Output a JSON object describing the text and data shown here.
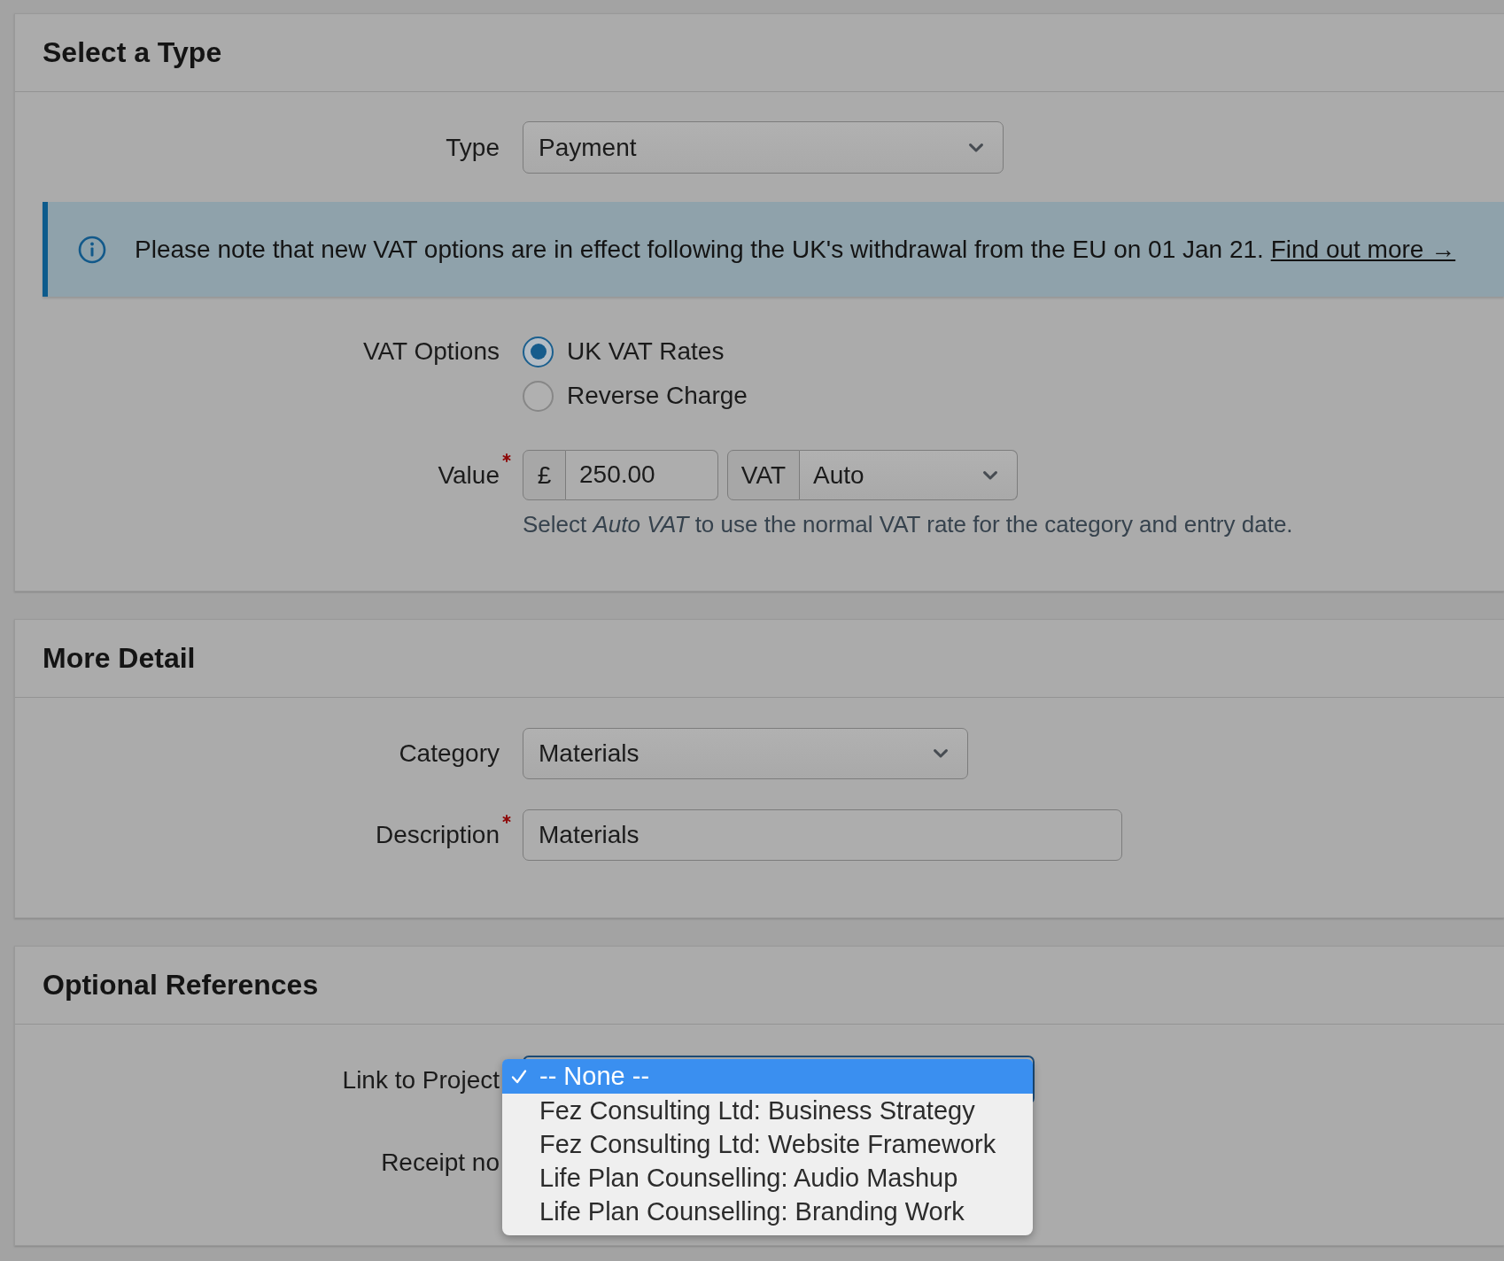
{
  "sections": [
    {
      "title": "Select a Type",
      "rows": [
        {
          "kind": "select",
          "label": "Type",
          "required": false,
          "value": "Payment"
        },
        {
          "kind": "notice",
          "text": "Please note that new VAT options are in effect following the UK's withdrawal from the EU on 01 Jan 21.",
          "link": "Find out more →"
        },
        {
          "kind": "radio",
          "label": "VAT Options",
          "required": false,
          "options": [
            {
              "label": "UK VAT Rates",
              "selected": true
            },
            {
              "label": "Reverse Charge",
              "selected": false
            }
          ]
        },
        {
          "kind": "money",
          "label": "Value",
          "required": true,
          "currency": "£",
          "amount": "250.00",
          "vat_label": "VAT",
          "vat_value": "Auto",
          "help": "Select *Auto VAT* to use the normal VAT rate for the category and entry date."
        }
      ]
    },
    {
      "title": "More Detail",
      "rows": [
        {
          "kind": "select",
          "label": "Category",
          "required": false,
          "value": "Materials"
        },
        {
          "kind": "text",
          "label": "Description",
          "required": true,
          "value": "Materials"
        }
      ]
    },
    {
      "title": "Optional References",
      "rows": [
        {
          "kind": "dropdown",
          "label": "Link to Project",
          "required": false,
          "expanded": true,
          "options": [
            {
              "label": "-- None --",
              "selected": true
            },
            {
              "label": "Fez Consulting Ltd: Business Strategy",
              "selected": false
            },
            {
              "label": "Fez Consulting Ltd: Website Framework",
              "selected": false
            },
            {
              "label": "Life Plan Counselling: Audio Mashup",
              "selected": false
            },
            {
              "label": "Life Plan Counselling: Branding Work",
              "selected": false
            }
          ]
        },
        {
          "kind": "covered",
          "label": "Receipt no",
          "required": false
        }
      ]
    }
  ]
}
